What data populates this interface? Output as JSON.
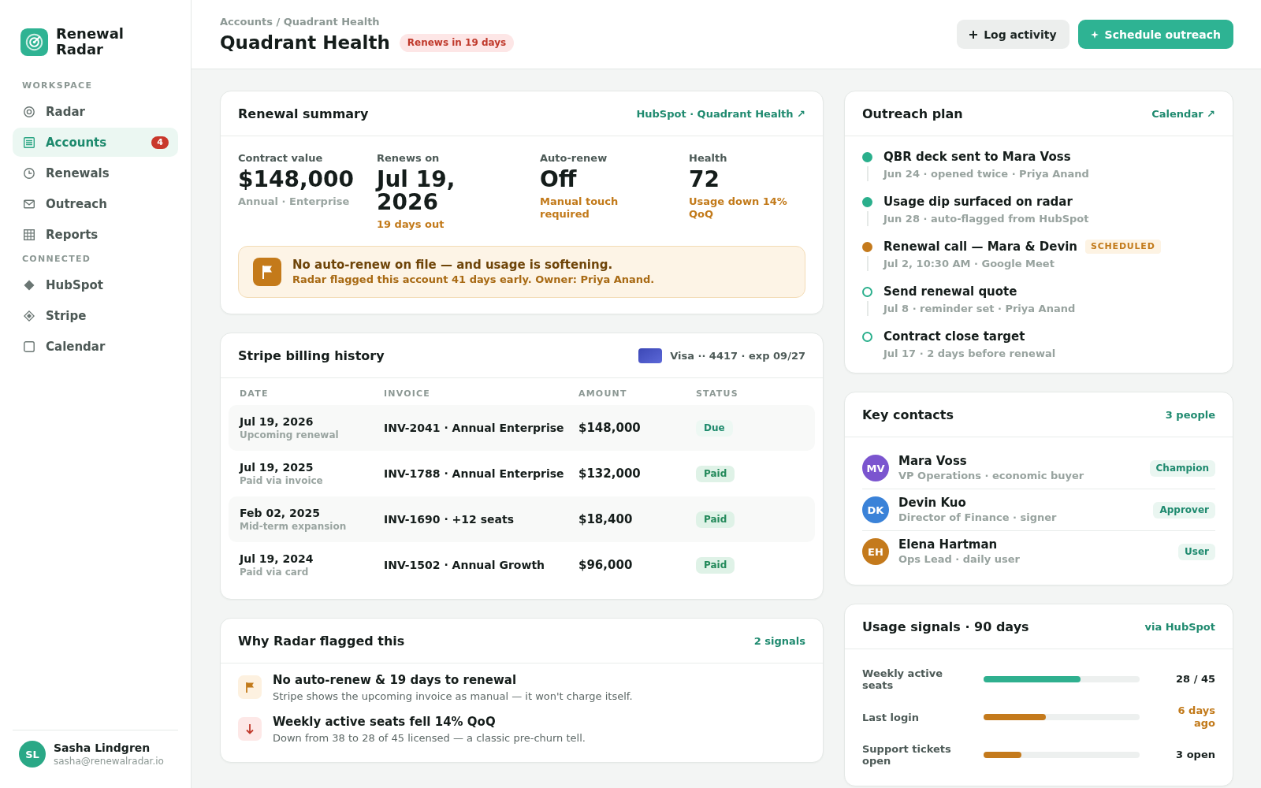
{
  "sidebar": {
    "brand": {
      "name": "Renewal Radar"
    },
    "sections": [
      {
        "heading": "WORKSPACE",
        "items": [
          {
            "label": "Radar",
            "kind": "target",
            "selected": false
          },
          {
            "label": "Accounts",
            "kind": "list",
            "selected": true,
            "badge": "4"
          },
          {
            "label": "Renewals",
            "kind": "clock",
            "selected": false
          },
          {
            "label": "Outreach",
            "kind": "envelope",
            "selected": false
          },
          {
            "label": "Reports",
            "kind": "grid",
            "selected": false
          }
        ]
      },
      {
        "heading": "CONNECTED",
        "items": [
          {
            "label": "HubSpot",
            "kind": "diamond",
            "selected": false
          },
          {
            "label": "Stripe",
            "kind": "nested-diamond",
            "selected": false
          },
          {
            "label": "Calendar",
            "kind": "square",
            "selected": false
          }
        ]
      }
    ],
    "user": {
      "initials": "SL",
      "name": "Sasha Lindgren",
      "email": "sasha@renewalradar.io"
    }
  },
  "header": {
    "breadcrumb": "Accounts / Quadrant Health",
    "title": "Quadrant Health",
    "badge": "Renews in 19 days",
    "actions": [
      {
        "label": "Log activity",
        "kind": "secondary"
      },
      {
        "label": "Schedule outreach",
        "kind": "primary"
      }
    ]
  },
  "renewal_summary": {
    "title": "Renewal summary",
    "link": "HubSpot · Quadrant Health ↗",
    "stats": [
      {
        "label": "Contract value",
        "value": "$148,000",
        "note": "Annual · Enterprise",
        "kind": "muted"
      },
      {
        "label": "Renews on",
        "value": "Jul 19, 2026",
        "note": "19 days out",
        "kind": "warning"
      },
      {
        "label": "Auto-renew",
        "value": "Off",
        "note": "Manual touch required",
        "kind": "warning"
      },
      {
        "label": "Health",
        "value": "72",
        "note": "Usage down 14% QoQ",
        "kind": "warning"
      }
    ],
    "alert": {
      "title": "No auto-renew on file — and usage is softening.",
      "detail": "Radar flagged this account 41 days early. Owner: Priya Anand."
    }
  },
  "billing_history": {
    "title": "Stripe billing history",
    "payment_method": "Visa ·· 4417 · exp 09/27",
    "columns": [
      "DATE",
      "INVOICE",
      "AMOUNT",
      "STATUS"
    ],
    "rows": [
      {
        "kind": "due",
        "date": "Jul 19, 2026",
        "date_note": "Upcoming renewal",
        "invoice": "INV-2041 · Annual Enterprise",
        "amount": "$148,000",
        "status": "Due"
      },
      {
        "kind": "paid",
        "date": "Jul 19, 2025",
        "date_note": "Paid via invoice",
        "invoice": "INV-1788 · Annual Enterprise",
        "amount": "$132,000",
        "status": "Paid"
      },
      {
        "kind": "paid",
        "date": "Feb 02, 2025",
        "date_note": "Mid-term expansion",
        "invoice": "INV-1690 · +12 seats",
        "amount": "$18,400",
        "status": "Paid"
      },
      {
        "kind": "paid",
        "date": "Jul 19, 2024",
        "date_note": "Paid via card",
        "invoice": "INV-1502 · Annual Growth",
        "amount": "$96,000",
        "status": "Paid"
      }
    ]
  },
  "flag_reasons": {
    "title": "Why Radar flagged this",
    "count": "2 signals",
    "items": [
      {
        "kind": "flag",
        "title": "No auto-renew & 19 days to renewal",
        "detail": "Stripe shows the upcoming invoice as manual — it won't charge itself."
      },
      {
        "kind": "drop",
        "title": "Weekly active seats fell 14% QoQ",
        "detail": "Down from 38 to 28 of 45 licensed — a classic pre-churn tell."
      }
    ]
  },
  "outreach_plan": {
    "title": "Outreach plan",
    "link": "Calendar ↗",
    "steps": [
      {
        "kind": "done",
        "title": "QBR deck sent to Mara Voss",
        "detail": "Jun 24 · opened twice · Priya Anand"
      },
      {
        "kind": "done",
        "title": "Usage dip surfaced on radar",
        "detail": "Jun 28 · auto-flagged from HubSpot"
      },
      {
        "kind": "scheduled",
        "title": "Renewal call — Mara & Devin",
        "tag": "SCHEDULED",
        "detail": "Jul 2, 10:30 AM · Google Meet"
      },
      {
        "kind": "upcoming",
        "title": "Send renewal quote",
        "detail": "Jul 8 · reminder set · Priya Anand"
      },
      {
        "kind": "upcoming",
        "title": "Contract close target",
        "detail": "Jul 17 · 2 days before renewal"
      }
    ]
  },
  "key_contacts": {
    "title": "Key contacts",
    "count": "3 people",
    "contacts": [
      {
        "initials": "MV",
        "name": "Mara Voss",
        "role": "VP Operations · economic buyer",
        "tag": "Champion",
        "color": "#7b55cf"
      },
      {
        "initials": "DK",
        "name": "Devin Kuo",
        "role": "Director of Finance · signer",
        "tag": "Approver",
        "color": "#3a82d8"
      },
      {
        "initials": "EH",
        "name": "Elena Hartman",
        "role": "Ops Lead · daily user",
        "tag": "User",
        "color": "#c47a1c"
      }
    ]
  },
  "usage_signals": {
    "title": "Usage signals · 90 days",
    "source": "via HubSpot",
    "signals": [
      {
        "label": "Weekly active seats",
        "level": 0.62,
        "reading": "28 / 45",
        "color": "#2fb08f",
        "warning": false
      },
      {
        "label": "Last login",
        "level": 0.4,
        "reading": "6 days ago",
        "color": "#c47a1c",
        "warning": true
      },
      {
        "label": "Support tickets open",
        "level": 0.24,
        "reading": "3 open",
        "color": "#c47a1c",
        "warning": false
      }
    ]
  }
}
